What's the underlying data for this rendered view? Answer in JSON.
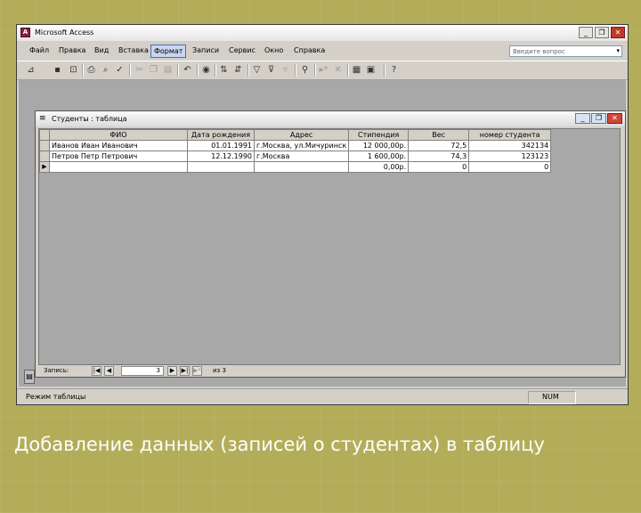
{
  "window": {
    "title": "Microsoft Access"
  },
  "menu": [
    "Файл",
    "Правка",
    "Вид",
    "Вставка",
    "Формат",
    "Записи",
    "Сервис",
    "Окно",
    "Справка"
  ],
  "ask_placeholder": "Введите вопрос",
  "child": {
    "title": "Студенты : таблица"
  },
  "table": {
    "headers": [
      "ФИО",
      "Дата рождения",
      "Адрес",
      "Стипендия",
      "Вес",
      "номер студента"
    ],
    "rows": [
      [
        "Иванов Иван Иванович",
        "01.01.1991",
        "г.Москва, ул.Мичуринск",
        "12 000,00р.",
        "72,5",
        "342134"
      ],
      [
        "Петров Петр Петрович",
        "12.12.1990",
        "г.Москва",
        "1 600,00р.",
        "74,3",
        "123123"
      ],
      [
        "",
        "",
        "",
        "0,00р.",
        "0",
        "0"
      ]
    ]
  },
  "nav": {
    "label": "Запись:",
    "current": "3",
    "of_label": "из 3"
  },
  "status": {
    "mode": "Режим таблицы",
    "num": "NUM"
  },
  "caption": "Добавление данных (записей о студентах) в таблицу"
}
